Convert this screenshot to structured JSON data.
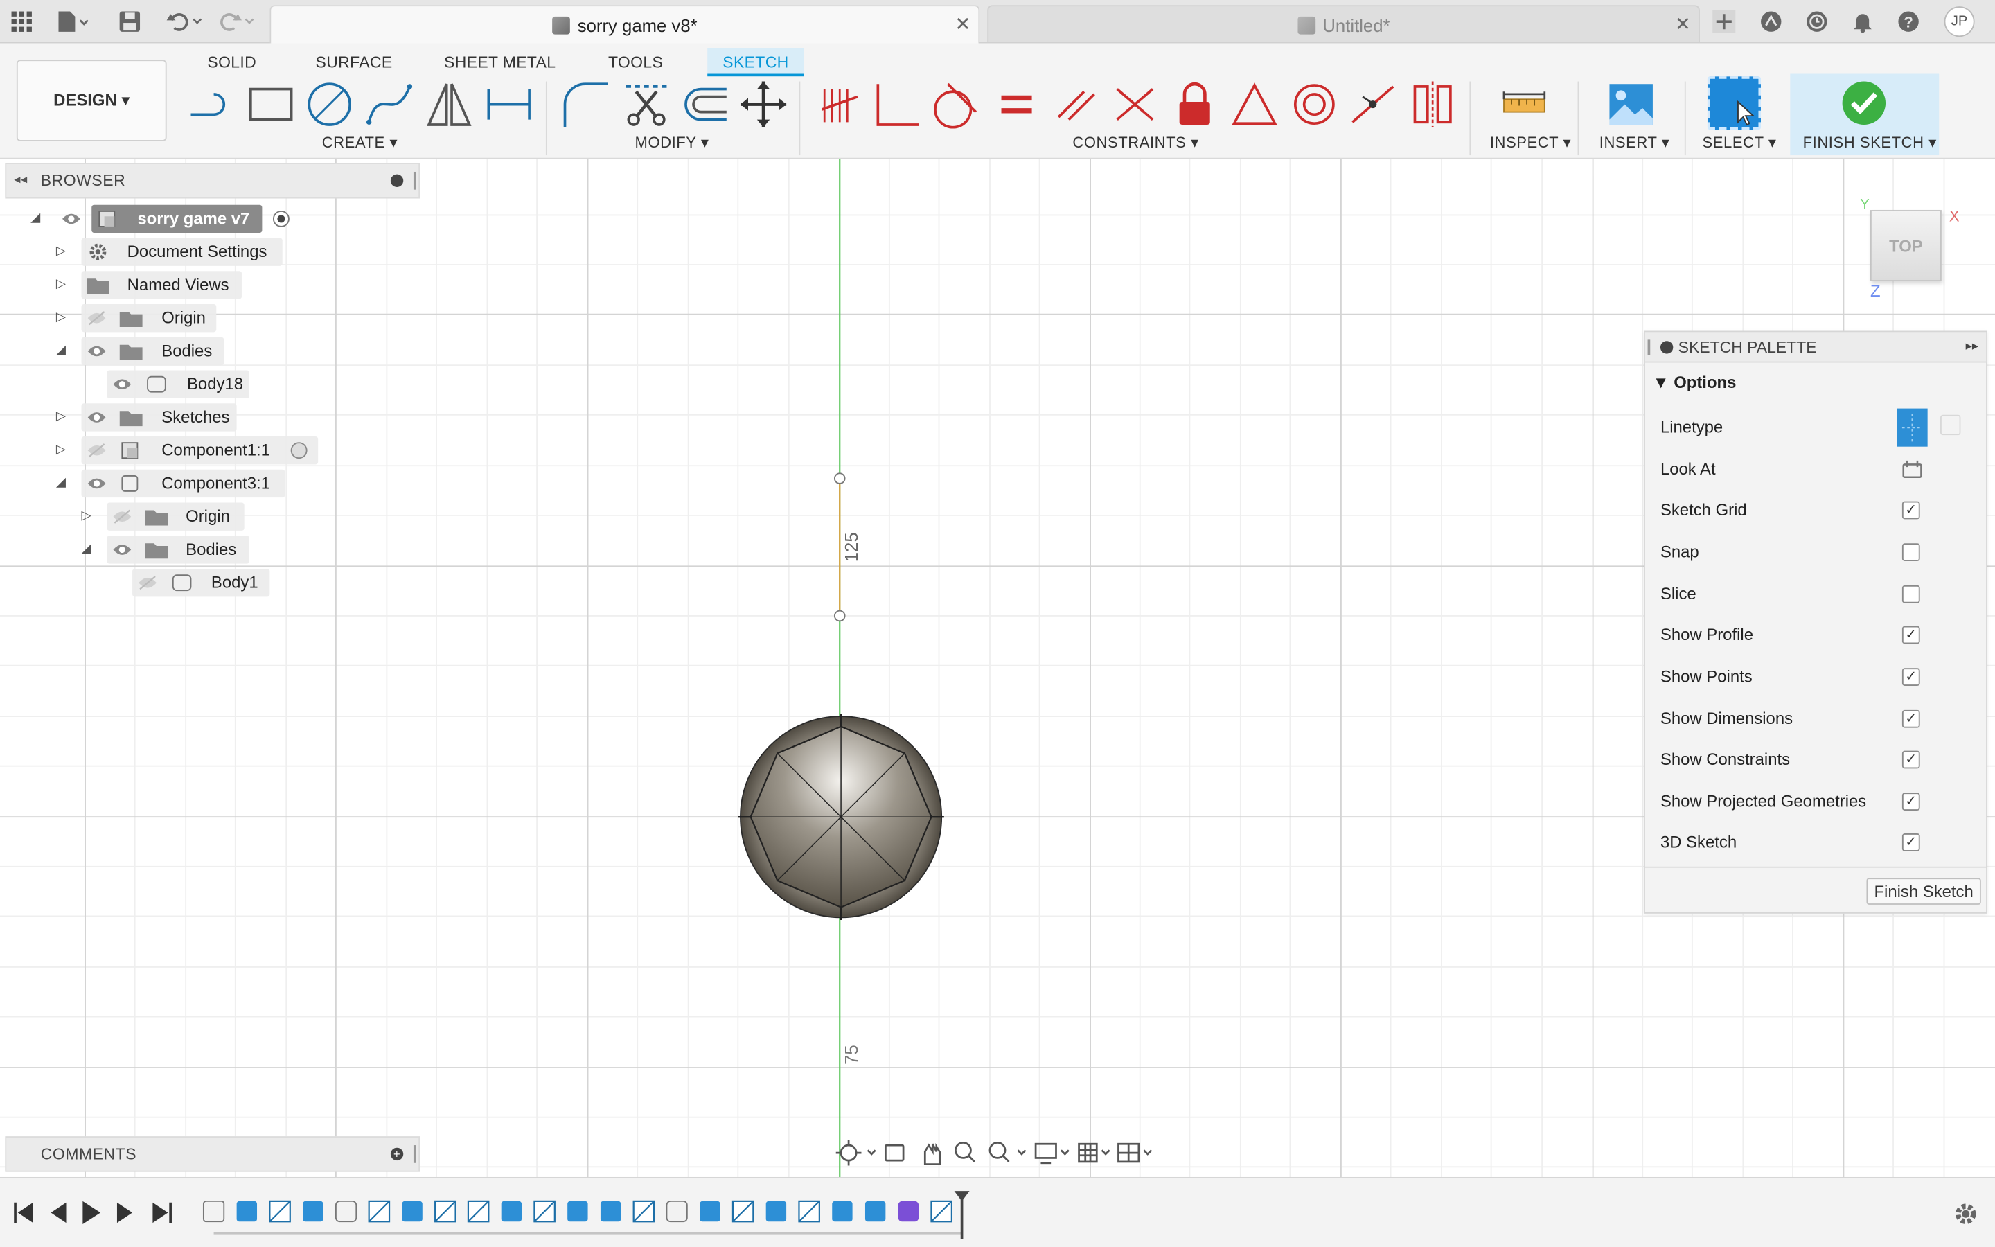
{
  "titlebar": {
    "active_tab": "sorry game v8*",
    "inactive_tab": "Untitled*",
    "user_initials": "JP"
  },
  "workspace_tabs": [
    "SOLID",
    "SURFACE",
    "SHEET METAL",
    "TOOLS",
    "SKETCH"
  ],
  "workspace_active": "SKETCH",
  "design_button": "DESIGN",
  "groups": {
    "create": "CREATE",
    "modify": "MODIFY",
    "constraints": "CONSTRAINTS",
    "inspect": "INSPECT",
    "insert": "INSERT",
    "select": "SELECT",
    "finish": "FINISH SKETCH"
  },
  "browser": {
    "title": "BROWSER",
    "items": [
      {
        "label": "sorry game v7"
      },
      {
        "label": "Document Settings"
      },
      {
        "label": "Named Views"
      },
      {
        "label": "Origin"
      },
      {
        "label": "Bodies"
      },
      {
        "label": "Body18"
      },
      {
        "label": "Sketches"
      },
      {
        "label": "Component1:1"
      },
      {
        "label": "Component3:1"
      },
      {
        "label": "Origin"
      },
      {
        "label": "Bodies"
      },
      {
        "label": "Body1"
      }
    ]
  },
  "comments": {
    "title": "COMMENTS"
  },
  "viewcube": {
    "face": "TOP",
    "axis_x": "X",
    "axis_y": "Y",
    "axis_z": "Z"
  },
  "sketch": {
    "dim_label_upper": "125",
    "dim_label_lower": "75"
  },
  "palette": {
    "title": "SKETCH PALETTE",
    "section": "Options",
    "options": [
      {
        "label": "Linetype"
      },
      {
        "label": "Look At"
      },
      {
        "label": "Sketch Grid",
        "checked": true
      },
      {
        "label": "Snap",
        "checked": false
      },
      {
        "label": "Slice",
        "checked": false
      },
      {
        "label": "Show Profile",
        "checked": true
      },
      {
        "label": "Show Points",
        "checked": true
      },
      {
        "label": "Show Dimensions",
        "checked": true
      },
      {
        "label": "Show Constraints",
        "checked": true
      },
      {
        "label": "Show Projected Geometries",
        "checked": true
      },
      {
        "label": "3D Sketch",
        "checked": true
      }
    ],
    "finish_button": "Finish Sketch"
  },
  "colors": {
    "accent": "#0696d7",
    "ok_green": "#3cb043",
    "constraint_red": "#cc2b2b",
    "axis_green": "#5fc75f"
  }
}
